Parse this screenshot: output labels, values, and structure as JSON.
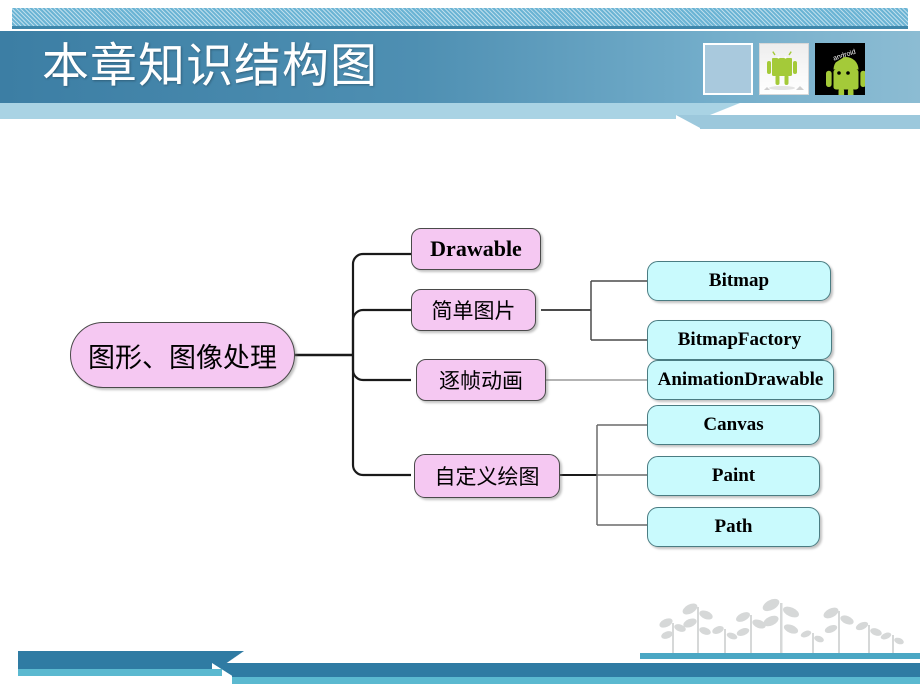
{
  "slide": {
    "title": "本章知识结构图",
    "accent_color": "#3c7ea4",
    "stripe_color": "#6bb4d4",
    "node_pink_color": "#f5c8f2",
    "node_blue_color": "#c9fafd"
  },
  "header": {
    "thumbnails": [
      {
        "name": "blank-slide-thumbnail",
        "label": ""
      },
      {
        "name": "android-robot-light-thumbnail",
        "label": ""
      },
      {
        "name": "android-robot-dark-thumbnail",
        "label": "android"
      }
    ]
  },
  "diagram": {
    "type": "mindmap",
    "root": {
      "label": "图形、图像处理",
      "script": "cjk"
    },
    "branches": [
      {
        "label": "Drawable",
        "script": "latin",
        "children": []
      },
      {
        "label": "简单图片",
        "script": "cjk",
        "children": [
          {
            "label": "Bitmap",
            "script": "latin"
          },
          {
            "label": "BitmapFactory",
            "script": "latin"
          }
        ]
      },
      {
        "label": "逐帧动画",
        "script": "cjk",
        "children": [
          {
            "label": "AnimationDrawable",
            "script": "latin"
          }
        ]
      },
      {
        "label": "自定义绘图",
        "script": "cjk",
        "children": [
          {
            "label": "Canvas",
            "script": "latin"
          },
          {
            "label": "Paint",
            "script": "latin"
          },
          {
            "label": "Path",
            "script": "latin"
          }
        ]
      }
    ]
  },
  "footer": {
    "decoration": "sprouts"
  }
}
